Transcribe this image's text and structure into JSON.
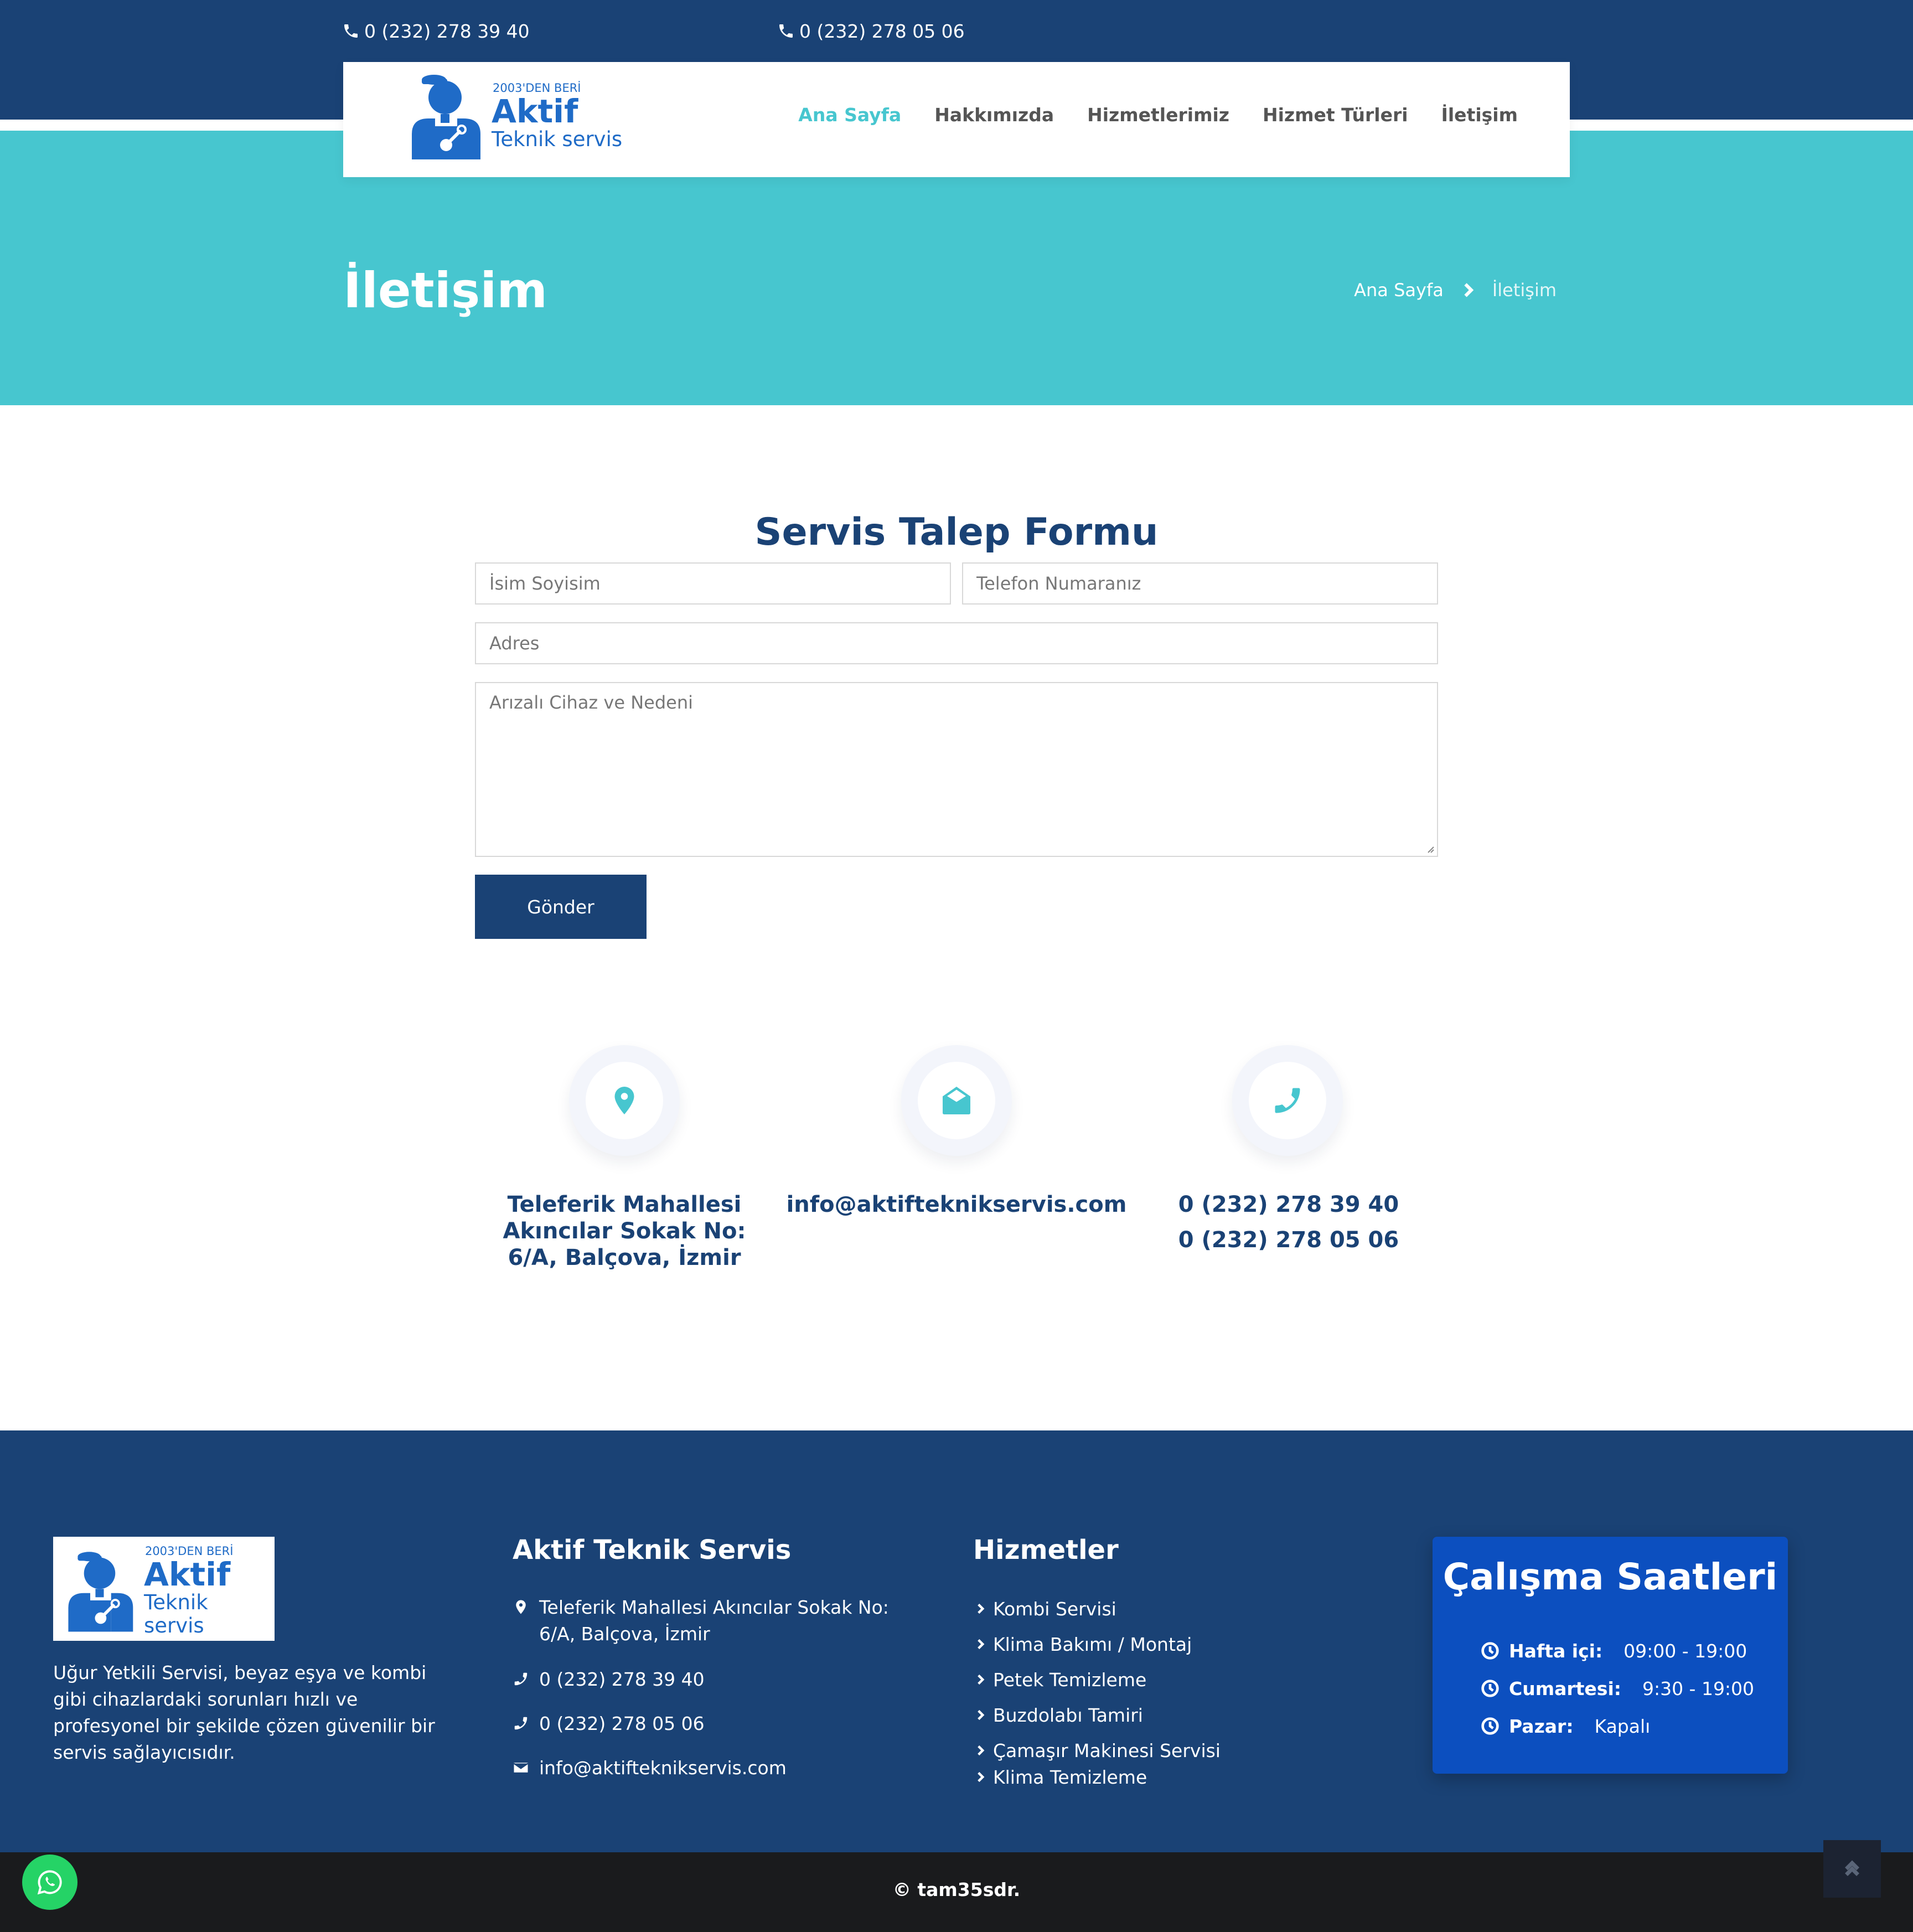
{
  "topbar": {
    "phone_1": "0 (232) 278 39 40",
    "phone_2": "0 (232) 278 05 06"
  },
  "brand": {
    "since": "2003'DEN BERİ",
    "name": "Aktif",
    "tagline": "Teknik servis",
    "color": "#1f6bc7"
  },
  "nav": {
    "items": [
      {
        "label": "Ana Sayfa",
        "active": true
      },
      {
        "label": "Hakkımızda",
        "active": false
      },
      {
        "label": "Hizmetlerimiz",
        "active": false
      },
      {
        "label": "Hizmet Türleri",
        "active": false
      },
      {
        "label": "İletişim",
        "active": false
      }
    ]
  },
  "hero": {
    "title": "İletişim",
    "breadcrumb": {
      "home": "Ana Sayfa",
      "current": "İletişim"
    },
    "color": "#47c6cf"
  },
  "form": {
    "title": "Servis Talep Formu",
    "name": {
      "placeholder": "İsim Soyisim",
      "value": ""
    },
    "phone": {
      "placeholder": "Telefon Numaranız",
      "value": ""
    },
    "address": {
      "placeholder": "Adres",
      "value": ""
    },
    "message": {
      "placeholder": "Arızalı Cihaz ve Nedeni",
      "value": ""
    },
    "submit_label": "Gönder"
  },
  "contact": {
    "address_icon": "map-pin-icon",
    "address": "Teleferik Mahallesi Akıncılar Sokak No: 6/A, Balçova, İzmir",
    "email_icon": "envelope-open-icon",
    "email": "info@aktifteknikservis.com",
    "phone_icon": "phone-icon",
    "phone_1": "0 (232) 278 39 40",
    "phone_2": "0 (232) 278 05 06"
  },
  "footer": {
    "about": "Uğur Yetkili Servisi, beyaz eşya ve kombi gibi cihazlardaki sorunları hızlı ve profesyonel bir şekilde çözen güvenilir bir servis sağlayıcısıdır.",
    "company": {
      "heading": "Aktif Teknik Servis",
      "address": "Teleferik Mahallesi Akıncılar Sokak No: 6/A, Balçova, İzmir",
      "phone_1": "0 (232) 278 39 40",
      "phone_2": "0 (232) 278 05 06",
      "email": "info@aktifteknikservis.com"
    },
    "services": {
      "heading": "Hizmetler",
      "items": [
        "Kombi Servisi",
        "Klima Bakımı / Montaj",
        "Petek Temizleme",
        "Buzdolabı Tamiri",
        "Çamaşır Makinesi Servisi",
        "Klima Temizleme"
      ]
    },
    "hours": {
      "title": "Çalışma Saatleri",
      "rows": [
        {
          "day": "Hafta içi:",
          "time": "09:00 - 19:00"
        },
        {
          "day": "Cumartesi:",
          "time": "9:30 - 19:00"
        },
        {
          "day": "Pazar:",
          "time": "Kapalı"
        }
      ]
    },
    "copyright": "© tam35sdr."
  },
  "colors": {
    "navy": "#1a4275",
    "teal": "#47c6cf",
    "hours_card": "#0c4fbf",
    "whatsapp": "#25d366"
  }
}
